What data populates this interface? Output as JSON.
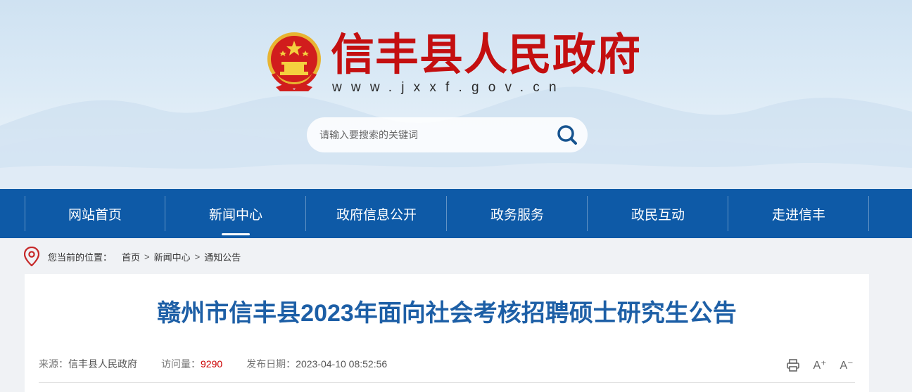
{
  "header": {
    "title": "信丰县人民政府",
    "url": "www.jxxf.gov.cn"
  },
  "search": {
    "placeholder": "请输入要搜索的关键词"
  },
  "nav": {
    "items": [
      {
        "label": "网站首页"
      },
      {
        "label": "新闻中心"
      },
      {
        "label": "政府信息公开"
      },
      {
        "label": "政务服务"
      },
      {
        "label": "政民互动"
      },
      {
        "label": "走进信丰"
      }
    ],
    "active": "新闻中心"
  },
  "breadcrumb": {
    "label": "您当前的位置：",
    "items": [
      "首页",
      "新闻中心",
      "通知公告"
    ],
    "separator": ">"
  },
  "article": {
    "title": "赣州市信丰县2023年面向社会考核招聘硕士研究生公告",
    "source_label": "来源：",
    "source": "信丰县人民政府",
    "views_label": "访问量：",
    "views": "9290",
    "date_label": "发布日期：",
    "date": "2023-04-10 08:52:56",
    "tools": {
      "print_icon": "print-icon",
      "font_larger": "A⁺",
      "font_smaller": "A⁻"
    }
  },
  "colors": {
    "brand_red": "#c40f10",
    "nav_blue": "#0e5aa7",
    "title_blue": "#1d5fa6"
  }
}
